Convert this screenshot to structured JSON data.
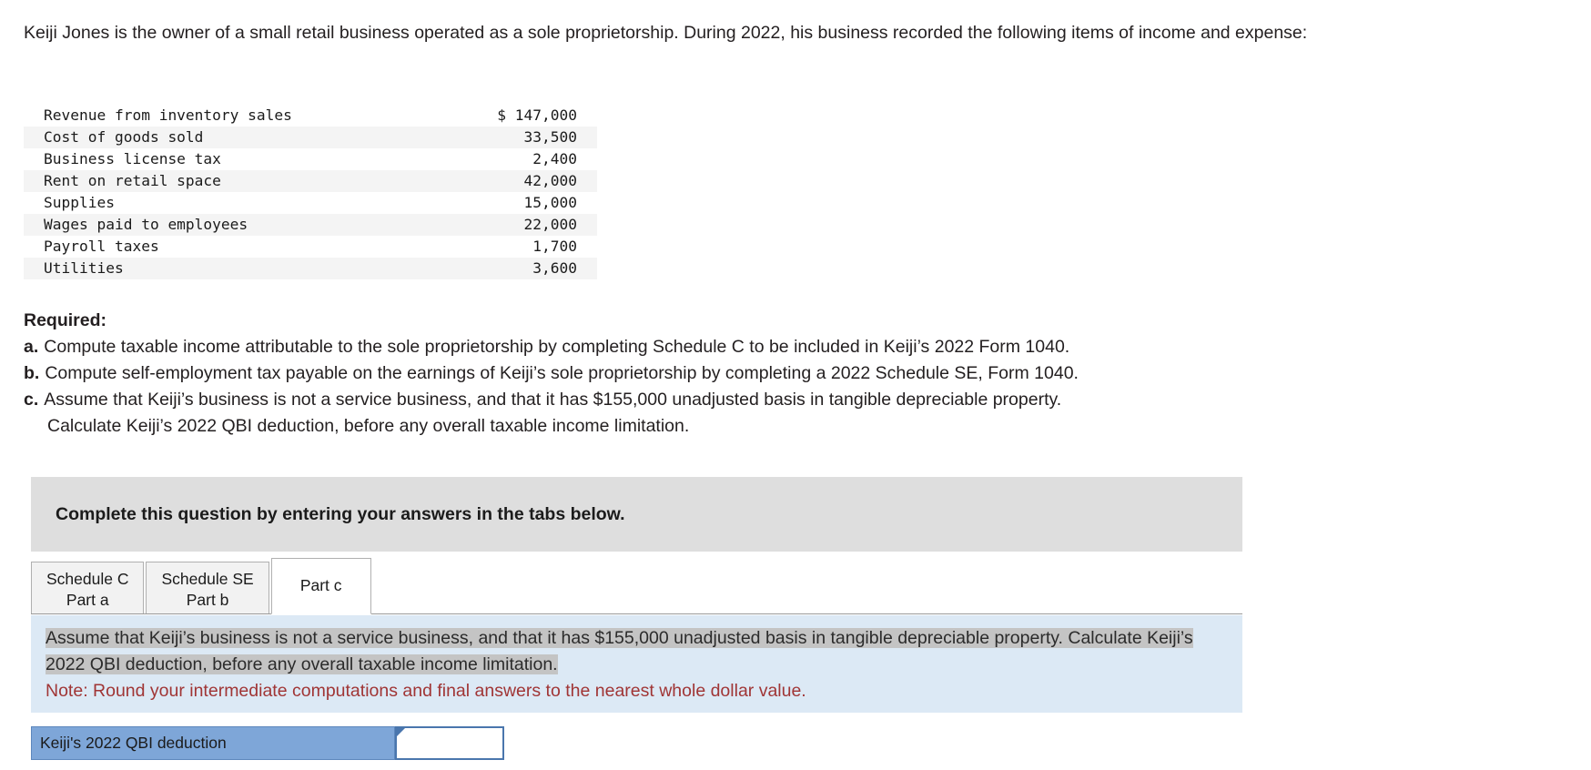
{
  "intro": {
    "text": "Keiji Jones is the owner of a small retail business operated as a sole proprietorship. During 2022, his business recorded the following items of income and expense:"
  },
  "facts_table": {
    "rows": [
      {
        "label": "Revenue from inventory sales",
        "amount": "$ 147,000"
      },
      {
        "label": "Cost of goods sold",
        "amount": "33,500"
      },
      {
        "label": "Business license tax",
        "amount": "2,400"
      },
      {
        "label": "Rent on retail space",
        "amount": "42,000"
      },
      {
        "label": "Supplies",
        "amount": "15,000"
      },
      {
        "label": "Wages paid to employees",
        "amount": "22,000"
      },
      {
        "label": "Payroll taxes",
        "amount": "1,700"
      },
      {
        "label": "Utilities",
        "amount": "3,600"
      }
    ]
  },
  "required": {
    "title": "Required:",
    "items": [
      {
        "letter": "a.",
        "text": "Compute taxable income attributable to the sole proprietorship by completing Schedule C to be included in Keiji’s 2022 Form 1040.",
        "continuation": ""
      },
      {
        "letter": "b.",
        "text": "Compute self-employment tax payable on the earnings of Keiji’s sole proprietorship by completing a 2022 Schedule SE, Form 1040.",
        "continuation": ""
      },
      {
        "letter": "c.",
        "text": "Assume that Keiji’s business is not a service business, and that it has $155,000 unadjusted basis in tangible depreciable property.",
        "continuation": "Calculate Keiji’s 2022 QBI deduction, before any overall taxable income limitation."
      }
    ]
  },
  "instruction": {
    "text": "Complete this question by entering your answers in the tabs below."
  },
  "tabs": [
    {
      "line1": "Schedule C",
      "line2": "Part a",
      "active": false
    },
    {
      "line1": "Schedule SE",
      "line2": "Part b",
      "active": false
    },
    {
      "line1": "Part c",
      "line2": "",
      "active": true
    }
  ],
  "question_panel": {
    "selected_text": "Assume that Keiji’s business is not a service business, and that it has $155,000 unadjusted basis in tangible depreciable property. Calculate Keiji’s 2022 QBI deduction, before any overall taxable income limitation.",
    "note": "Note: Round your intermediate computations and final answers to the nearest whole dollar value."
  },
  "answer_row": {
    "label": "Keiji's 2022 QBI deduction",
    "value": "",
    "placeholder": ""
  },
  "colors": {
    "panel_blue": "#dce9f5",
    "answer_blue": "#7ea6d8",
    "instruction_gray": "#dedede",
    "selection_gray": "#c4c4c4",
    "note_red": "#a03535"
  }
}
